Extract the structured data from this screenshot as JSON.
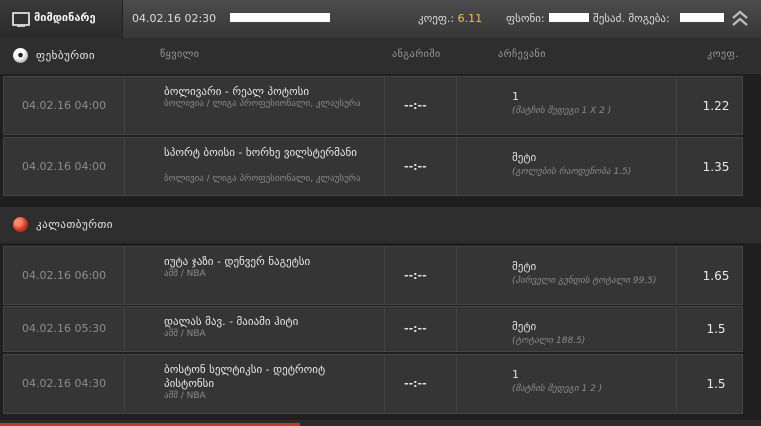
{
  "topbar": {
    "live_label": "მიმდინარე",
    "datetime": "04.02.16 02:30",
    "coef_label": "კოეფ.:",
    "coef_value": "6.11",
    "bet_label": "ფსონი:",
    "possible_win_label": "შესაძ. მოგება:"
  },
  "columns": {
    "event": "წყვილი",
    "score": "ანგარიში",
    "choice": "არჩევანი",
    "coef": "კოეფ."
  },
  "sections": [
    {
      "title": "ფეხბურთი",
      "icon": "soccer-ball-icon",
      "show_columns": true,
      "rows": [
        {
          "date": "04.02.16 04:00",
          "match": "ბოლივარი - რეალ პოტოსი",
          "league": "ბოლივია / ლიგა პროფესიონალი, კლაუსურა",
          "score": "--:--",
          "pick": "1",
          "market": "(მატჩის შედეგი 1 X 2 )",
          "coef": "1.22"
        },
        {
          "date": "04.02.16 04:00",
          "match": "სპორტ ბოისი - ხორხე ვილსტერმანი",
          "league": "ბოლივია / ლიგა პროფესიონალი, კლაუსურა",
          "score": "--:--",
          "pick": "მეტი",
          "market": "(გოლების რაოდენობა 1.5)",
          "coef": "1.35"
        }
      ]
    },
    {
      "title": "კალათბურთი",
      "icon": "basketball-icon",
      "show_columns": false,
      "rows": [
        {
          "date": "04.02.16 06:00",
          "match": "იუტა ჯაზი - დენვერ ნაგეტსი",
          "league": "აშშ / NBA",
          "score": "--:--",
          "pick": "მეტი",
          "market": "(პირველი გუნდის ტოტალი 99.5)",
          "coef": "1.65"
        },
        {
          "date": "04.02.16 05:30",
          "match": "დალას მავ. - მაიამი ჰიტი",
          "league": "აშშ / NBA",
          "score": "--:--",
          "pick": "მეტი",
          "market": "(ტოტალი 188.5)",
          "coef": "1.5"
        },
        {
          "date": "04.02.16 04:30",
          "match": "ბოსტონ სელტიკსი - დეტროიტ პისტონსი",
          "league": "აშშ / NBA",
          "score": "--:--",
          "pick": "1",
          "market": "(მატჩის შედეგი 1 2 )",
          "coef": "1.5"
        }
      ]
    }
  ]
}
